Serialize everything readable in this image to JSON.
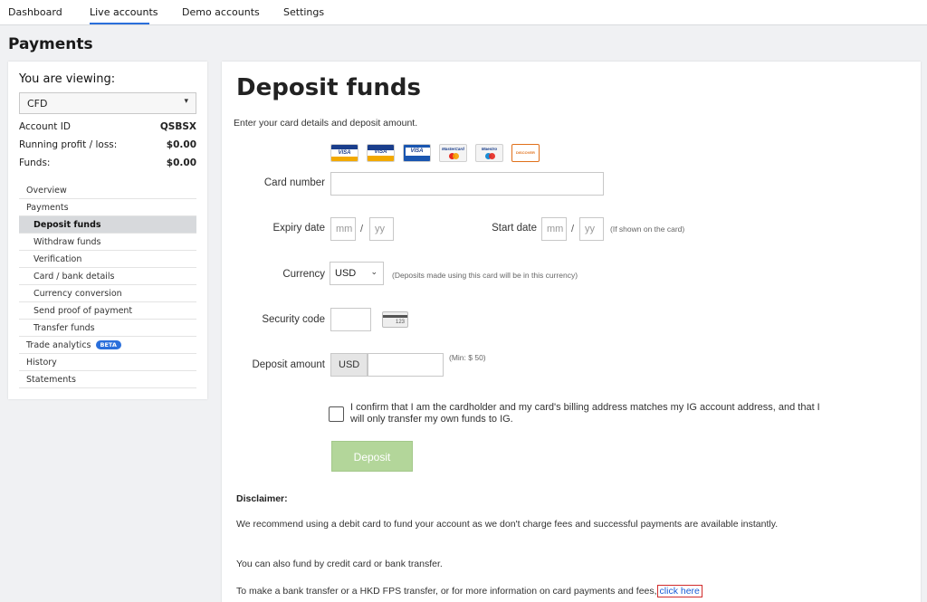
{
  "nav": {
    "tabs": [
      {
        "label": "Dashboard"
      },
      {
        "label": "Live accounts",
        "active": true
      },
      {
        "label": "Demo accounts"
      },
      {
        "label": "Settings"
      }
    ]
  },
  "page": {
    "title": "Payments"
  },
  "sidebar": {
    "viewing_label": "You are viewing:",
    "account_type": "CFD",
    "account_id_label": "Account ID",
    "account_id": "QSBSX",
    "pl_label": "Running profit / loss:",
    "pl_value": "$0.00",
    "funds_label": "Funds:",
    "funds_value": "$0.00",
    "menu": [
      {
        "label": "Overview"
      },
      {
        "label": "Payments"
      },
      {
        "label": "Deposit funds",
        "active": true
      },
      {
        "label": "Withdraw funds"
      },
      {
        "label": "Verification"
      },
      {
        "label": "Card / bank details"
      },
      {
        "label": "Currency conversion"
      },
      {
        "label": "Send proof of payment"
      },
      {
        "label": "Transfer funds"
      },
      {
        "label": "Trade analytics",
        "badge": "BETA"
      },
      {
        "label": "History"
      },
      {
        "label": "Statements"
      }
    ]
  },
  "form": {
    "heading": "Deposit funds",
    "intro": "Enter your card details and deposit amount.",
    "card_logos": [
      {
        "icon": "visa-icon",
        "text": "VISA"
      },
      {
        "icon": "visa-debit-icon",
        "text": "VISA"
      },
      {
        "icon": "visa-electron-icon",
        "text": "VISA"
      },
      {
        "icon": "mastercard-icon",
        "text": "MasterCard"
      },
      {
        "icon": "maestro-icon",
        "text": "Maestro"
      },
      {
        "icon": "discover-icon",
        "text": "DISCOVER"
      }
    ],
    "card_number_label": "Card number",
    "expiry_label": "Expiry date",
    "start_label": "Start date",
    "mm_placeholder": "mm",
    "yy_placeholder": "yy",
    "slash": "/",
    "start_note": "(If shown on the card)",
    "currency_label": "Currency",
    "currency_value": "USD",
    "currency_note": "(Deposits made using this card will be in this currency)",
    "security_label": "Security code",
    "cvv_hint": "123",
    "amount_label": "Deposit amount",
    "amount_currency": "USD",
    "amount_min": "(Min: $ 50)",
    "confirm_text": "I confirm that I am the cardholder and my card's billing address matches my IG account address, and that I will only transfer my own funds to IG.",
    "deposit_button": "Deposit"
  },
  "disclaimer": {
    "title": "Disclaimer:",
    "p1": "We recommend using a debit card to fund your account as we don't charge fees and successful payments are available instantly.",
    "p2": "You can also fund by credit card or bank transfer.",
    "p3": "To make a bank transfer or a HKD FPS transfer, or for more information on card payments and fees,",
    "link": "click here"
  },
  "colors": {
    "accent": "#2a6fdb",
    "deposit_button": "#b3d69a",
    "link": "#1a5cd6",
    "highlight_box": "#d12c2c"
  }
}
